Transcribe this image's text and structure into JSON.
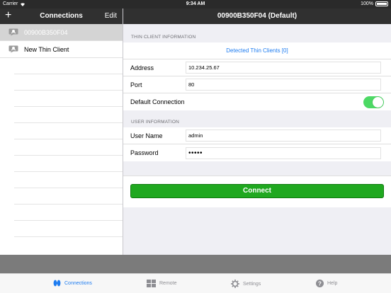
{
  "status_bar": {
    "carrier": "Carrier",
    "time": "9:34 AM",
    "battery": "100%"
  },
  "sidebar": {
    "title": "Connections",
    "add_label": "+",
    "edit_label": "Edit",
    "items": [
      {
        "label": "00900B350F04",
        "selected": true
      },
      {
        "label": "New Thin Client",
        "selected": false
      }
    ]
  },
  "detail": {
    "title": "00900B350F04 (Default)",
    "thin_client_section": "THIN CLIENT INFORMATION",
    "detected_link": "Detected Thin Clients [0]",
    "address_label": "Address",
    "address_value": "10.234.25.67",
    "port_label": "Port",
    "port_value": "80",
    "default_label": "Default Connection",
    "default_on": true,
    "user_section": "USER INFORMATION",
    "username_label": "User Name",
    "username_value": "admin",
    "password_label": "Password",
    "password_value": "•••••",
    "connect_label": "Connect"
  },
  "tabs": [
    {
      "label": "Connections",
      "icon": "connections-icon",
      "active": true
    },
    {
      "label": "Remote",
      "icon": "remote-icon",
      "active": false
    },
    {
      "label": "Settings",
      "icon": "settings-gear-icon",
      "active": false
    },
    {
      "label": "Help",
      "icon": "help-icon",
      "active": false
    }
  ],
  "colors": {
    "accent": "#1e7cf0",
    "connect": "#1fa81f",
    "toggle_on": "#4cd964",
    "navbar": "#303030"
  }
}
